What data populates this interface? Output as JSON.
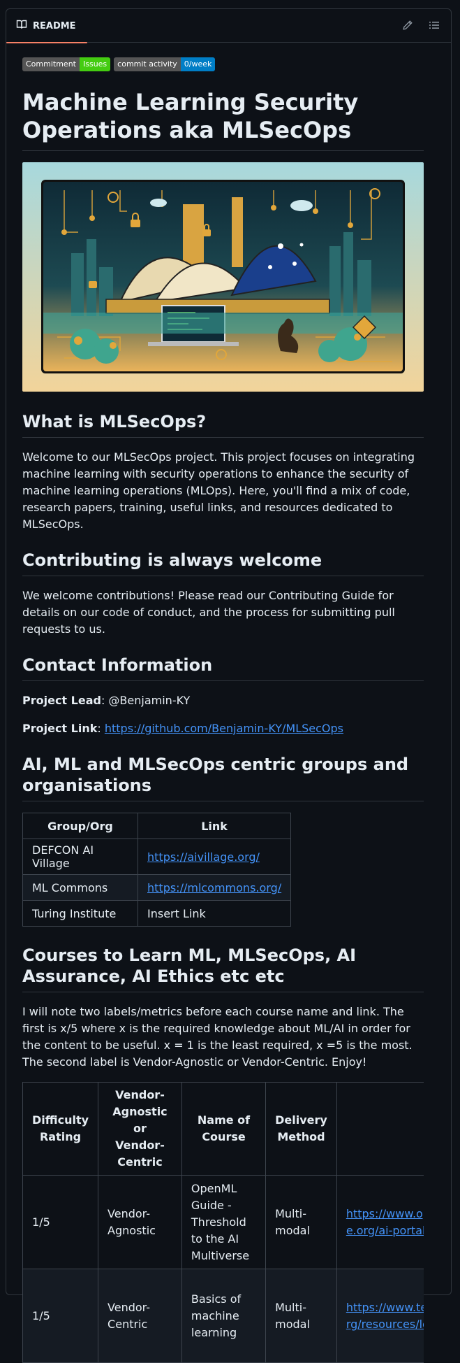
{
  "header": {
    "tab_label": "README",
    "edit_label": "Edit file",
    "outline_label": "Outline"
  },
  "badges": [
    {
      "left": "Commitment",
      "right": "Issues",
      "color": "#4c1"
    },
    {
      "left": "commit activity",
      "right": "0/week",
      "color": "#007ec6"
    }
  ],
  "title": "Machine Learning Security Operations aka MLSecOps",
  "sections": {
    "what": {
      "heading": "What is MLSecOps?",
      "text": "Welcome to our MLSecOps project. This project focuses on integrating machine learning with security operations to enhance the security of machine learning operations (MLOps). Here, you'll find a mix of code, research papers, training, useful links, and resources dedicated to MLSecOps."
    },
    "contributing": {
      "heading": "Contributing is always welcome",
      "text": "We welcome contributions! Please read our Contributing Guide for details on our code of conduct, and the process for submitting pull requests to us."
    },
    "contact": {
      "heading": "Contact Information",
      "lead_label": "Project Lead",
      "lead_value": ": @Benjamin-KY",
      "link_label": "Project Link",
      "link_sep": ": ",
      "link_value": "https://github.com/Benjamin-KY/MLSecOps"
    },
    "groups": {
      "heading": "AI, ML and MLSecOps centric groups and organisations",
      "columns": [
        "Group/Org",
        "Link"
      ],
      "rows": [
        {
          "name": "DEFCON AI Village",
          "link": "https://aivillage.org/",
          "is_link": true
        },
        {
          "name": "ML Commons",
          "link": "https://mlcommons.org/",
          "is_link": true
        },
        {
          "name": "Turing Institute",
          "link": "Insert Link",
          "is_link": false
        }
      ]
    },
    "courses": {
      "heading": "Courses to Learn ML, MLSecOps, AI Assurance, AI Ethics etc etc",
      "text": "I will note two labels/metrics before each course name and link. The first is x/5 where x is the required knowledge about ML/AI in order for the content to be useful. x = 1 is the least required, x =5 is the most. The second label is Vendor-Agnostic or Vendor-Centric. Enjoy!",
      "columns": [
        "Difficulty Rating",
        "Vendor-Agnostic or Vendor-Centric",
        "Name of Course",
        "Delivery Method",
        ""
      ],
      "rows": [
        {
          "rating": "1/5",
          "vendor": "Vendor-Agnostic",
          "name": "OpenML Guide - Threshold to the AI Multiverse",
          "method": "Multi-modal",
          "link": "https://www.openmlguide.org/ai-portal-gun/"
        },
        {
          "rating": "1/5",
          "vendor": "Vendor-Centric",
          "name": "Basics of machine learning",
          "method": "Multi-modal",
          "link": "https://www.tensorflow.org/resources/learn-ml"
        }
      ]
    }
  }
}
